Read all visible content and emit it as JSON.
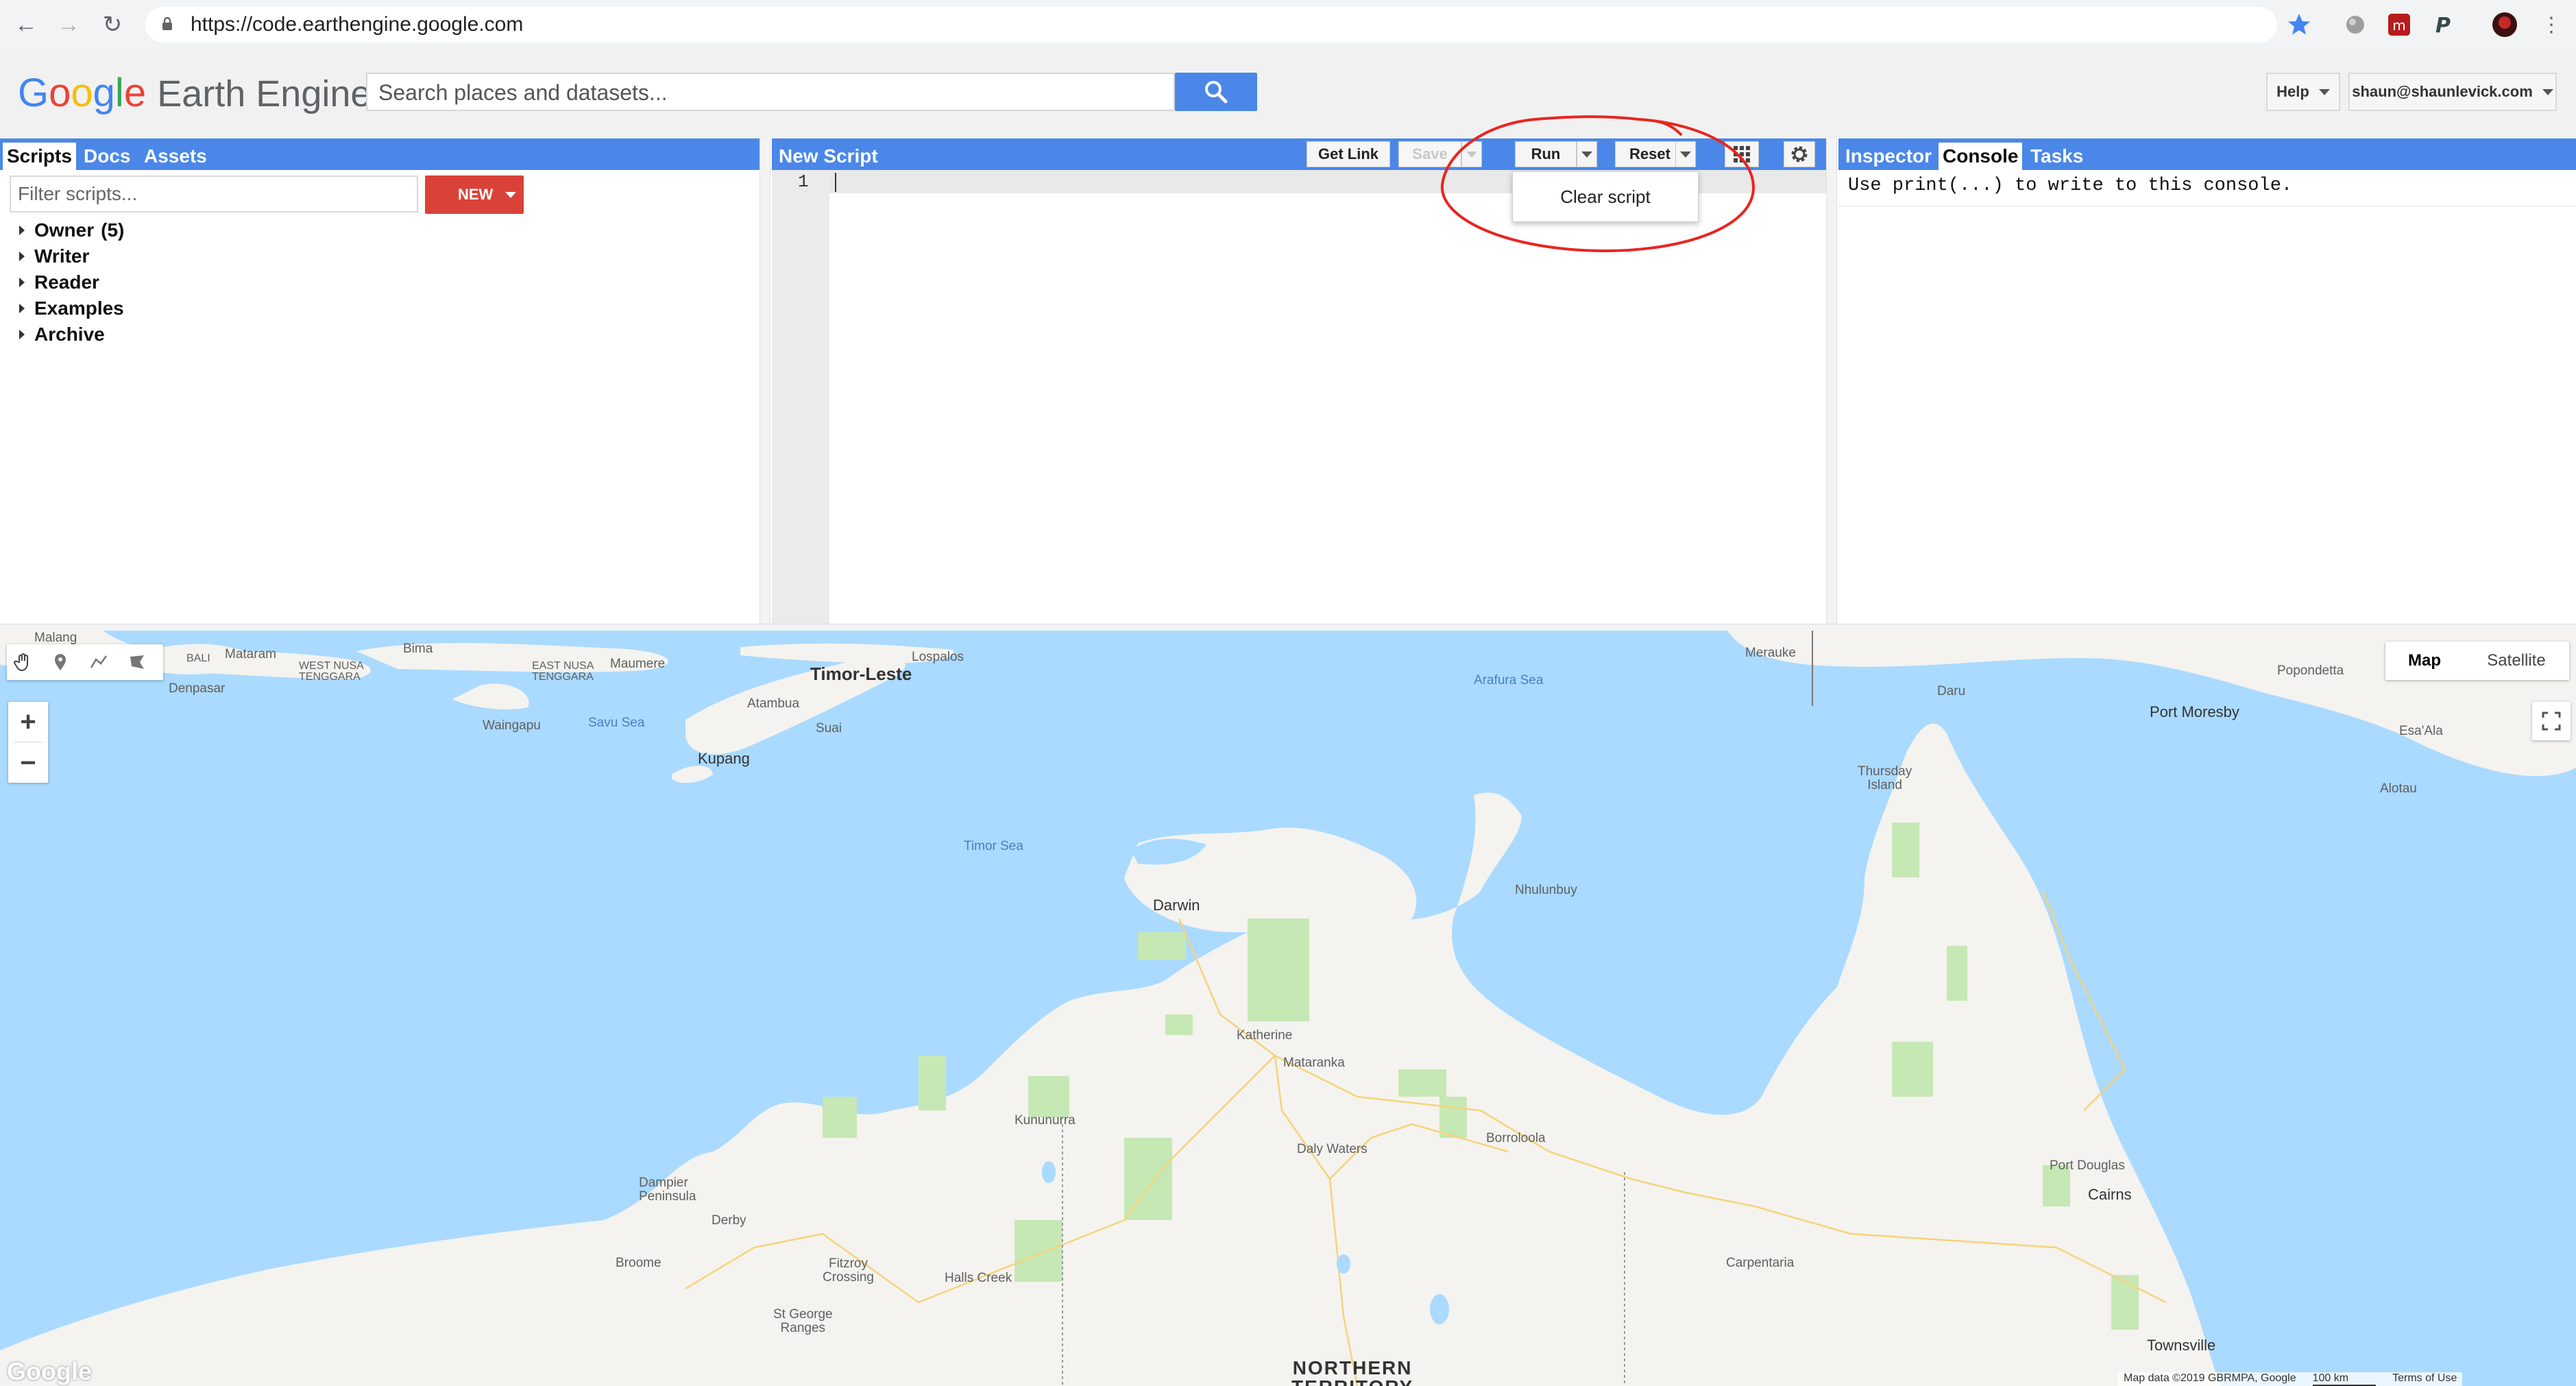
{
  "browser": {
    "url": "https://code.earthengine.google.com"
  },
  "header": {
    "logo_google": "Google",
    "logo_product": "Earth Engine",
    "search_placeholder": "Search places and datasets...",
    "help_label": "Help",
    "account_label": "shaun@shaunlevick.com"
  },
  "left_panel": {
    "tabs": [
      "Scripts",
      "Docs",
      "Assets"
    ],
    "active_tab": "Scripts",
    "filter_placeholder": "Filter scripts...",
    "new_label": "NEW",
    "tree": [
      {
        "label": "Owner",
        "count": "(5)"
      },
      {
        "label": "Writer",
        "count": ""
      },
      {
        "label": "Reader",
        "count": ""
      },
      {
        "label": "Examples",
        "count": ""
      },
      {
        "label": "Archive",
        "count": ""
      }
    ]
  },
  "editor": {
    "title": "New Script",
    "get_link_label": "Get Link",
    "save_label": "Save",
    "run_label": "Run",
    "reset_label": "Reset",
    "line_number": "1",
    "reset_menu": {
      "clear_script_label": "Clear script"
    }
  },
  "right_panel": {
    "tabs": [
      "Inspector",
      "Console",
      "Tasks"
    ],
    "active_tab": "Console",
    "console_message": "Use print(...) to write to this console."
  },
  "map": {
    "type_buttons": [
      "Map",
      "Satellite"
    ],
    "active_type": "Map",
    "zoom_in": "+",
    "zoom_out": "−",
    "google_mark": "Google",
    "attribution": [
      "Map data ©2019 GBRMPA, Google",
      "100 km",
      "Terms of Use"
    ],
    "labels": {
      "malang": "Malang",
      "bali": "BALI",
      "mataram": "Mataram",
      "bima": "Bima",
      "west_nusa": "WEST NUSA\nTENGGARA",
      "east_nusa": "EAST NUSA\nTENGGARA",
      "maumere": "Maumere",
      "lospalos": "Lospalos",
      "timor_leste": "Timor-Leste",
      "denpasar": "Denpasar",
      "waingapu": "Waingapu",
      "savu_sea": "Savu Sea",
      "atambua": "Atambua",
      "suai": "Suai",
      "kupang": "Kupang",
      "arafura_sea": "Arafura Sea",
      "merauke": "Merauke",
      "daru": "Daru",
      "popondetta": "Popondetta",
      "port_moresby": "Port Moresby",
      "esa_ala": "Esa'Ala",
      "alotau": "Alotau",
      "thursday_island": "Thursday\nIsland",
      "timor_sea": "Timor Sea",
      "nhulunbuy": "Nhulunbuy",
      "darwin": "Darwin",
      "katherine": "Katherine",
      "mataranka": "Mataranka",
      "kununurra": "Kununurra",
      "daly_waters": "Daly Waters",
      "borroloola": "Borroloola",
      "dampier": "Dampier\nPeninsula",
      "derby": "Derby",
      "broome": "Broome",
      "fitzroy": "Fitzroy\nCrossing",
      "halls_creek": "Halls Creek",
      "st_george": "St George\nRanges",
      "carpentaria": "Carpentaria",
      "port_douglas": "Port Douglas",
      "cairns": "Cairns",
      "townsville": "Townsville",
      "northern_territory": "NORTHERN\nTERRITORY"
    }
  },
  "colors": {
    "panel_blue": "#4a87e8",
    "new_red": "#d94238",
    "water": "#aadaff",
    "land": "#f4f3ef",
    "park": "#c6e8b4",
    "annotation_red": "#e8251f"
  }
}
